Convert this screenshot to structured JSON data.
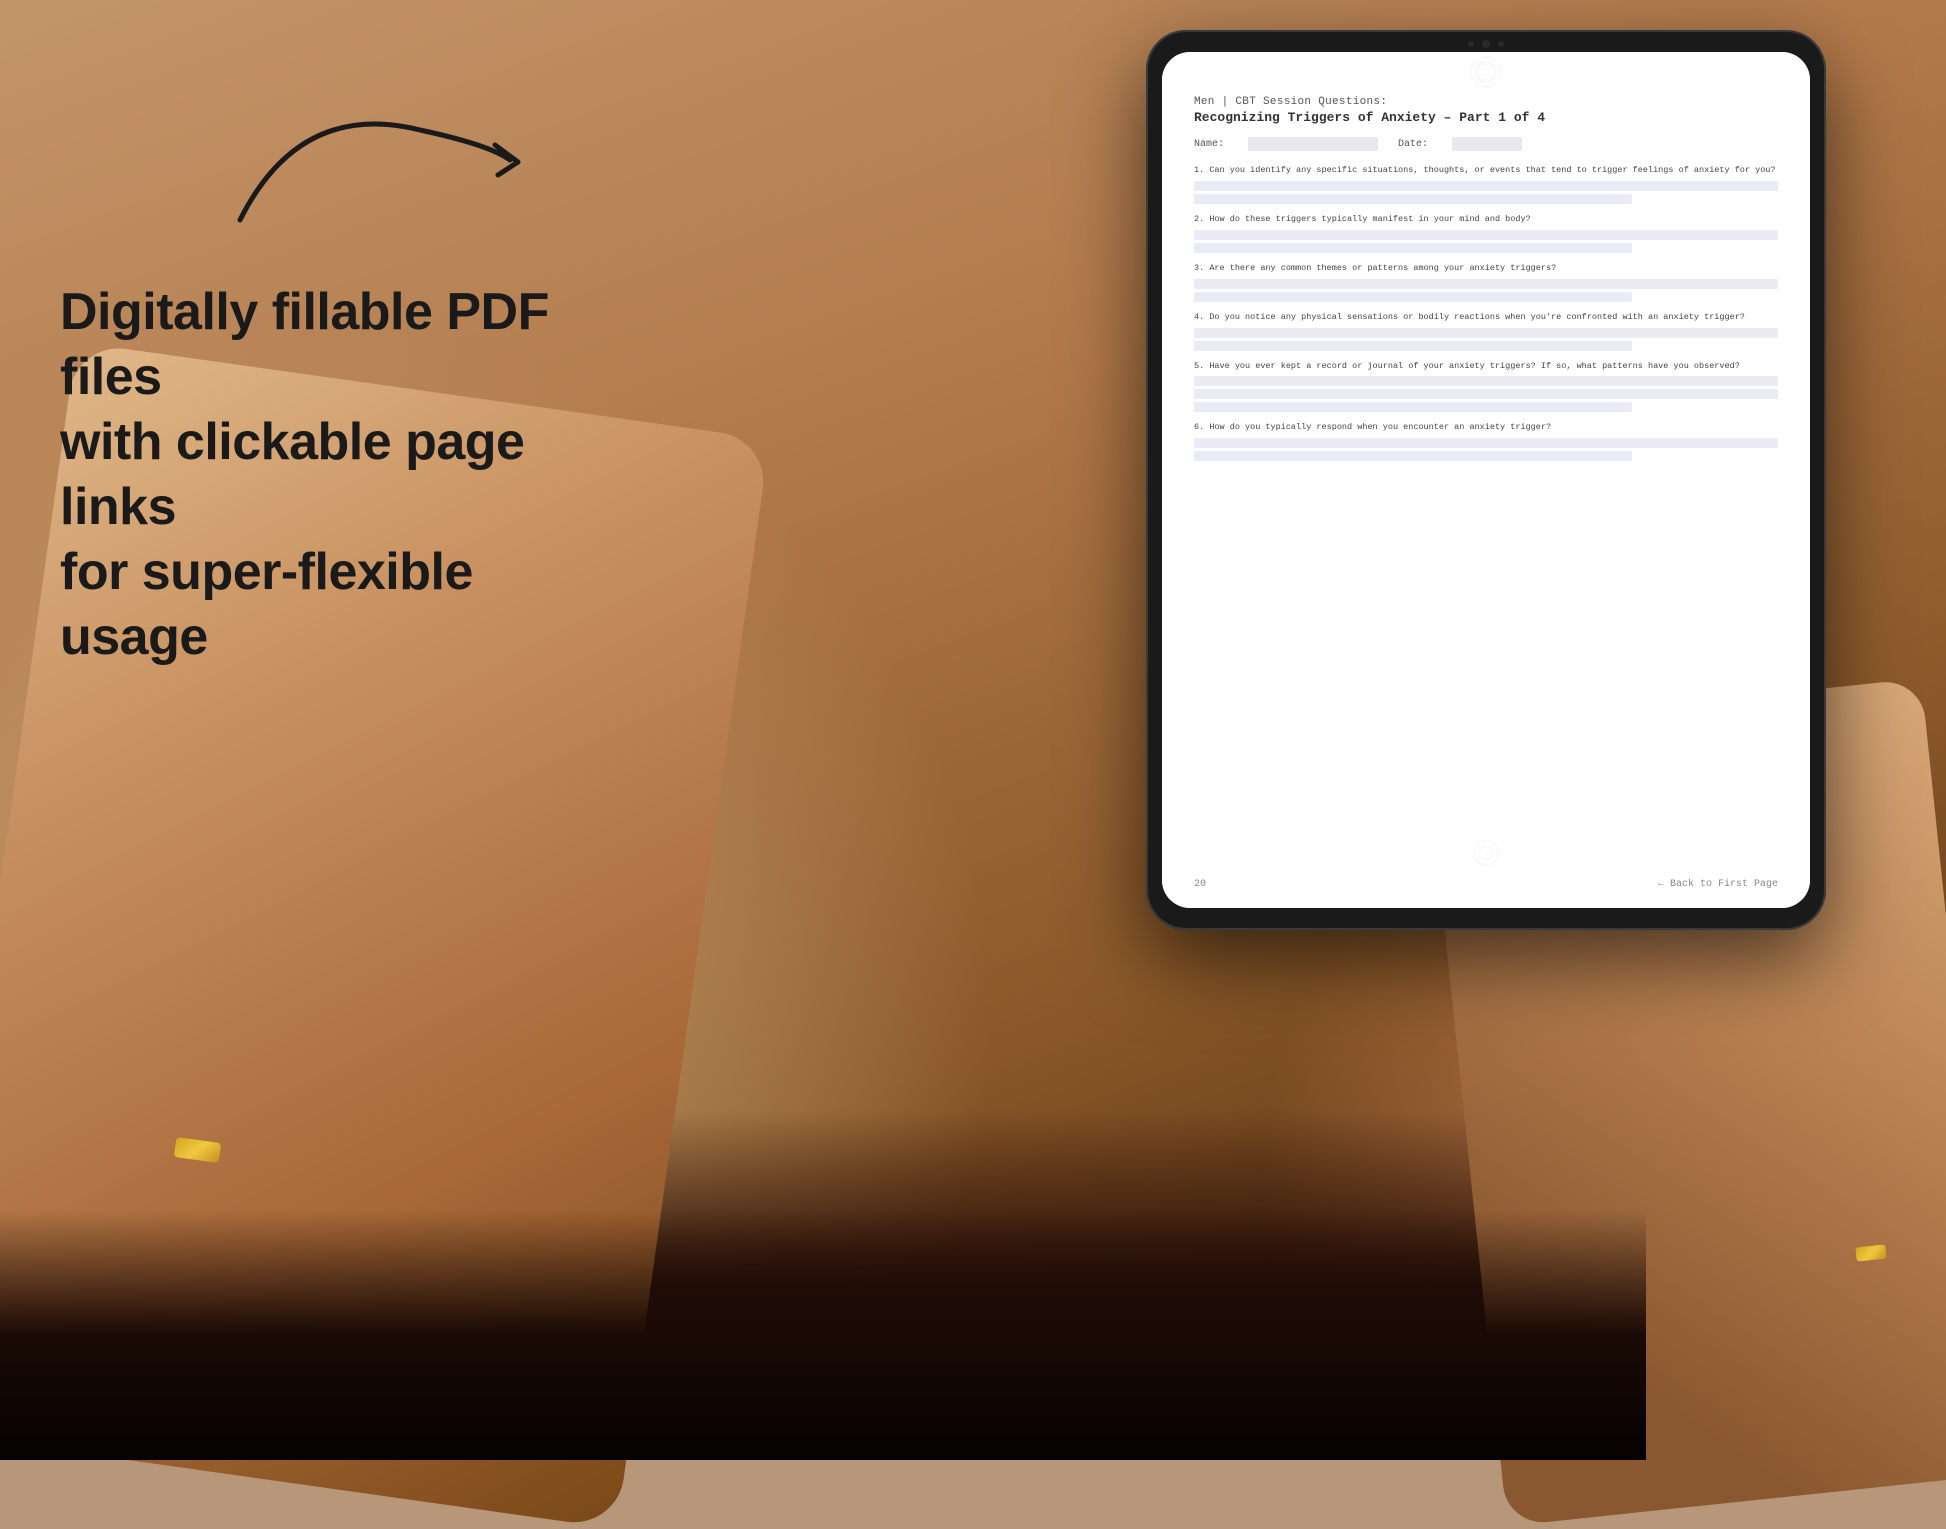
{
  "background": {
    "color": "#b8967a"
  },
  "left_text": {
    "line1": "Digitally fillable PDF files",
    "line2": "with clickable page links",
    "line3": "for super-flexible usage"
  },
  "arrow": {
    "description": "curved arrow pointing right toward tablet"
  },
  "tablet": {
    "title": "iPad tablet device"
  },
  "pdf": {
    "doc_type": "Men | CBT Session Questions:",
    "doc_title": "Recognizing Triggers of Anxiety – Part 1 of 4",
    "name_label": "Name:",
    "date_label": "Date:",
    "questions": [
      {
        "number": "1.",
        "text": "Can you identify any specific situations, thoughts, or events that tend to trigger feelings of anxiety for you?"
      },
      {
        "number": "2.",
        "text": "How do these triggers typically manifest in your mind and body?"
      },
      {
        "number": "3.",
        "text": "Are there any common themes or patterns among your anxiety triggers?"
      },
      {
        "number": "4.",
        "text": "Do you notice any physical sensations or bodily reactions when you're confronted with an anxiety trigger?"
      },
      {
        "number": "5.",
        "text": "Have you ever kept a record or journal of your anxiety triggers? If so, what patterns have you observed?"
      },
      {
        "number": "6.",
        "text": "How do you typically respond when you encounter an anxiety trigger?"
      }
    ],
    "footer": {
      "page_number": "20",
      "back_link": "← Back to First Page"
    }
  }
}
